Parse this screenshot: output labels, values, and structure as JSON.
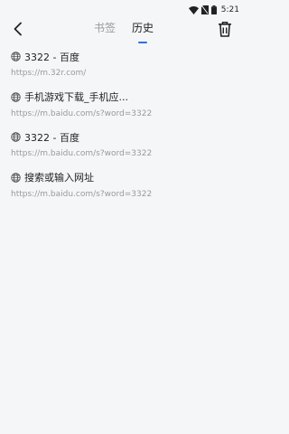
{
  "status_bar": {
    "time": "5:21"
  },
  "nav": {
    "tabs": [
      {
        "label": "书签",
        "active": false
      },
      {
        "label": "历史",
        "active": true
      }
    ],
    "accent_color": "#2f6fe4"
  },
  "history": [
    {
      "title": "3322 - 百度",
      "url": "https://m.32r.com/"
    },
    {
      "title": "手机游戏下载_手机应...",
      "url": "https://m.baidu.com/s?word=3322"
    },
    {
      "title": "3322 - 百度",
      "url": "https://m.baidu.com/s?word=3322"
    },
    {
      "title": "搜索或输入网址",
      "url": "https://m.baidu.com/s?word=3322"
    }
  ]
}
